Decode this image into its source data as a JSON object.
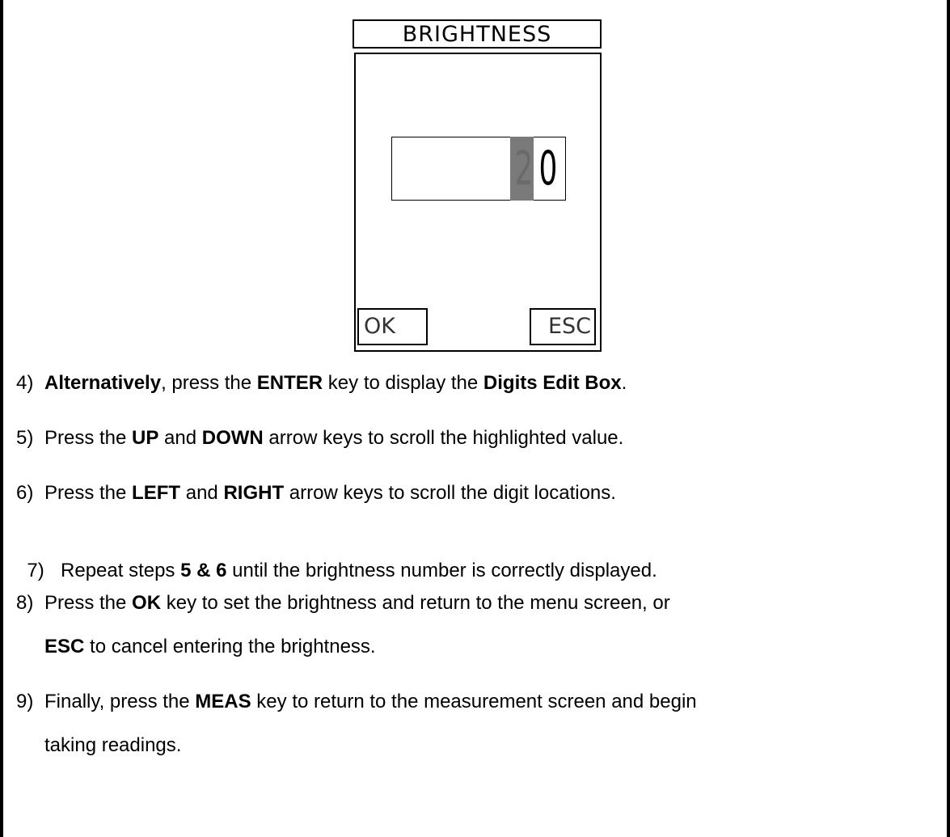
{
  "screen": {
    "title": "BRIGHTNESS",
    "digit_1": "2",
    "digit_2": "0",
    "softkey_ok": "OK",
    "softkey_esc": "ESC"
  },
  "steps": [
    {
      "number": "4)",
      "parts": [
        "Alternatively",
        ", press the ",
        "ENTER",
        " key to display the ",
        "Digits Edit Box",
        "."
      ]
    },
    {
      "number": "5)",
      "parts": [
        "Press the ",
        "UP",
        " and ",
        "DOWN",
        " arrow keys to scroll the highlighted value."
      ]
    },
    {
      "number": "6)",
      "parts": [
        "Press the ",
        "LEFT",
        " and ",
        "RIGHT",
        " arrow keys to scroll the digit locations."
      ]
    },
    {
      "number": "7)",
      "parts": [
        " Repeat steps ",
        "5 & 6",
        " until the brightness number is correctly displayed."
      ]
    },
    {
      "number": "8)",
      "parts": [
        "Press the ",
        "OK",
        " key to set the brightness and return to the menu screen, or"
      ],
      "cont": [
        "ESC",
        " to cancel entering the brightness."
      ]
    },
    {
      "number": "9)",
      "parts": [
        "Finally, press the ",
        "MEAS",
        " key to return to the measurement screen and begin"
      ],
      "cont": [
        "taking readings."
      ]
    }
  ]
}
